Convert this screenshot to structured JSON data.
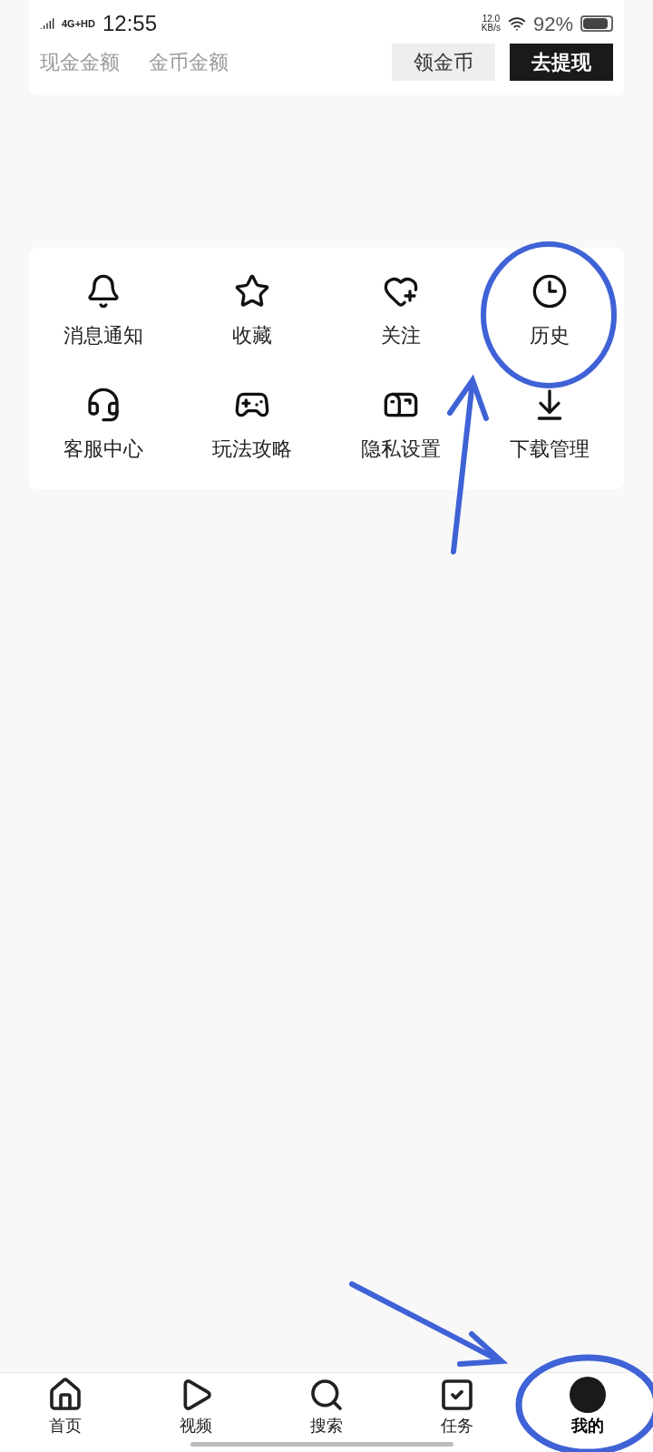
{
  "status_bar": {
    "network": "4G+HD",
    "time": "12:55",
    "speed": "12.0",
    "speed_unit": "KB/s",
    "battery": "92%"
  },
  "wallet_card": {
    "labels": [
      "现金金额",
      "金币金额"
    ],
    "buttons": [
      {
        "label": "领金币",
        "kind": "light"
      },
      {
        "label": "去提现",
        "kind": "dark"
      }
    ]
  },
  "menu": [
    {
      "label": "消息通知"
    },
    {
      "label": "收藏"
    },
    {
      "label": "关注"
    },
    {
      "label": "历史"
    },
    {
      "label": "客服中心"
    },
    {
      "label": "玩法攻略"
    },
    {
      "label": "隐私设置"
    },
    {
      "label": "下载管理"
    }
  ],
  "bottom_nav": [
    {
      "label": "首页",
      "selected": false
    },
    {
      "label": "视频",
      "selected": false
    },
    {
      "label": "搜索",
      "selected": false
    },
    {
      "label": "任务",
      "selected": false
    },
    {
      "label": "我的",
      "selected": true
    }
  ]
}
